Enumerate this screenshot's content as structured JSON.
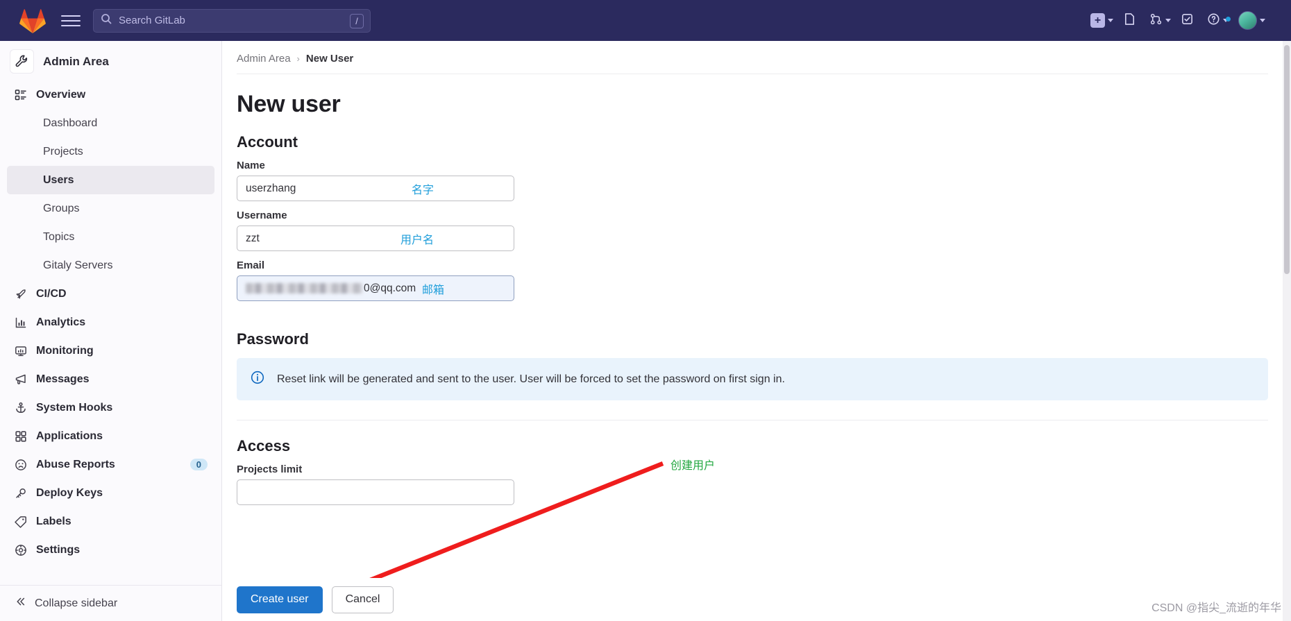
{
  "navbar": {
    "logo_icon": "gitlab-fox-logo",
    "menu_icon": "hamburger-menu-icon",
    "search": {
      "placeholder": "Search GitLab",
      "value": "",
      "shortcut_key": "/",
      "icon": "search-icon"
    },
    "actions": [
      {
        "name": "create-new",
        "icon": "plus-square-icon",
        "has_caret": true
      },
      {
        "name": "issues",
        "icon": "issues-icon",
        "has_caret": false
      },
      {
        "name": "merge-requests",
        "icon": "merge-request-icon",
        "has_caret": true
      },
      {
        "name": "todos",
        "icon": "todo-checklist-icon",
        "has_caret": false
      },
      {
        "name": "help",
        "icon": "help-circle-icon",
        "has_caret": true,
        "has_dot": true
      },
      {
        "name": "user-menu",
        "icon": "avatar",
        "has_caret": true
      }
    ]
  },
  "sidebar": {
    "title": "Admin Area",
    "title_icon": "wrench-icon",
    "items": [
      {
        "label": "Overview",
        "icon": "overview-list-icon",
        "level": "top",
        "active": false
      },
      {
        "label": "Dashboard",
        "icon": "",
        "level": "sub",
        "active": false
      },
      {
        "label": "Projects",
        "icon": "",
        "level": "sub",
        "active": false
      },
      {
        "label": "Users",
        "icon": "",
        "level": "sub",
        "active": true
      },
      {
        "label": "Groups",
        "icon": "",
        "level": "sub",
        "active": false
      },
      {
        "label": "Topics",
        "icon": "",
        "level": "sub",
        "active": false
      },
      {
        "label": "Gitaly Servers",
        "icon": "",
        "level": "sub",
        "active": false
      },
      {
        "label": "CI/CD",
        "icon": "rocket-icon",
        "level": "top",
        "active": false
      },
      {
        "label": "Analytics",
        "icon": "chart-bar-icon",
        "level": "top",
        "active": false
      },
      {
        "label": "Monitoring",
        "icon": "monitor-icon",
        "level": "top",
        "active": false
      },
      {
        "label": "Messages",
        "icon": "megaphone-icon",
        "level": "top",
        "active": false
      },
      {
        "label": "System Hooks",
        "icon": "anchor-icon",
        "level": "top",
        "active": false
      },
      {
        "label": "Applications",
        "icon": "grid-apps-icon",
        "level": "top",
        "active": false
      },
      {
        "label": "Abuse Reports",
        "icon": "frown-face-icon",
        "level": "top",
        "active": false,
        "badge": "0"
      },
      {
        "label": "Deploy Keys",
        "icon": "key-icon",
        "level": "top",
        "active": false
      },
      {
        "label": "Labels",
        "icon": "label-tag-icon",
        "level": "top",
        "active": false
      },
      {
        "label": "Settings",
        "icon": "gear-icon",
        "level": "top",
        "active": false
      }
    ],
    "collapse": {
      "label": "Collapse sidebar",
      "icon": "chevron-double-left-icon"
    }
  },
  "breadcrumb": {
    "parent": "Admin Area",
    "separator": "›",
    "current": "New User"
  },
  "page": {
    "title": "New user",
    "account_section": "Account",
    "password_section": "Password",
    "access_section": "Access",
    "fields": {
      "name": {
        "label": "Name",
        "value": "userzhang",
        "annotation_cn": "名字",
        "focused": false
      },
      "username": {
        "label": "Username",
        "value": "zzt",
        "annotation_cn": "用户名",
        "focused": false
      },
      "email": {
        "label": "Email",
        "value": "0@qq.com",
        "redacted": true,
        "annotation_cn": "邮箱",
        "focused": true
      },
      "projects_limit": {
        "label": "Projects limit",
        "value": ""
      }
    },
    "password_alert": {
      "icon": "info-circle-icon",
      "text": "Reset link will be generated and sent to the user. User will be forced to set the password on first sign in."
    }
  },
  "annotations": {
    "green_note": "创建用户",
    "green_color": "#22a73f",
    "arrow_color": "#ef1d1d",
    "blue_color": "#1f9eda"
  },
  "footer": {
    "create_button": "Create user",
    "cancel_button": "Cancel"
  },
  "watermark": "CSDN @指尖_流逝的年华"
}
